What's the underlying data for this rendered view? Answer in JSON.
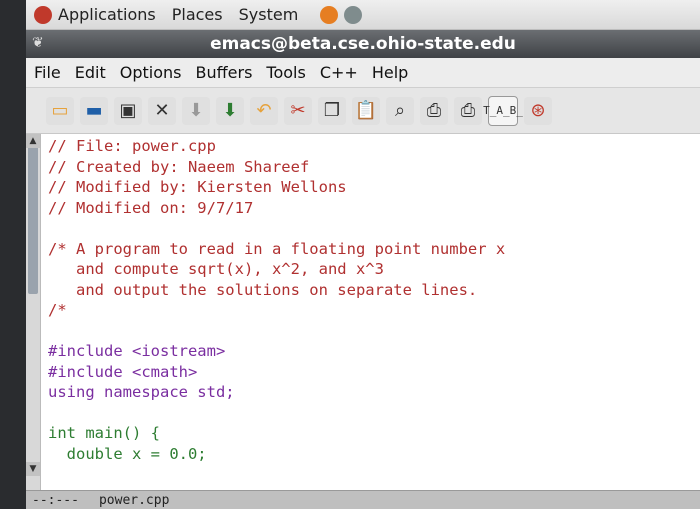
{
  "panel": {
    "applications": "Applications",
    "places": "Places",
    "system": "System"
  },
  "window": {
    "title": "emacs@beta.cse.ohio-state.edu"
  },
  "menubar": {
    "items": [
      "File",
      "Edit",
      "Options",
      "Buffers",
      "Tools",
      "C++",
      "Help"
    ]
  },
  "toolbar": {
    "icons": [
      "new-file-icon",
      "open-folder-icon",
      "save-icon",
      "close-icon",
      "save-as-icon",
      "insert-file-icon",
      "undo-icon",
      "cut-icon",
      "copy-icon",
      "paste-icon",
      "print-icon",
      "search-icon",
      "print-buffer-icon",
      "customize-icon",
      "help-icon"
    ],
    "customize_text": "T̲A̲B̲"
  },
  "editor": {
    "lines": [
      "// File: power.cpp",
      "// Created by: Naeem Shareef",
      "// Modified by: Kiersten Wellons",
      "// Modified on: 9/7/17",
      "",
      "/* A program to read in a floating point number x",
      "   and compute sqrt(x), x^2, and x^3",
      "   and output the solutions on separate lines.",
      "/*",
      "",
      "#include <iostream>",
      "#include <cmath>",
      "using namespace std;",
      "",
      "int main() {",
      "  double x = 0.0;"
    ]
  },
  "modeline": {
    "status": "--:---",
    "buffer": "power.cpp"
  },
  "colors": {
    "comment": "#b03030",
    "preprocessor": "#7a2ea0",
    "type": "#2e7d32",
    "titlebar": "#4a4d51"
  }
}
